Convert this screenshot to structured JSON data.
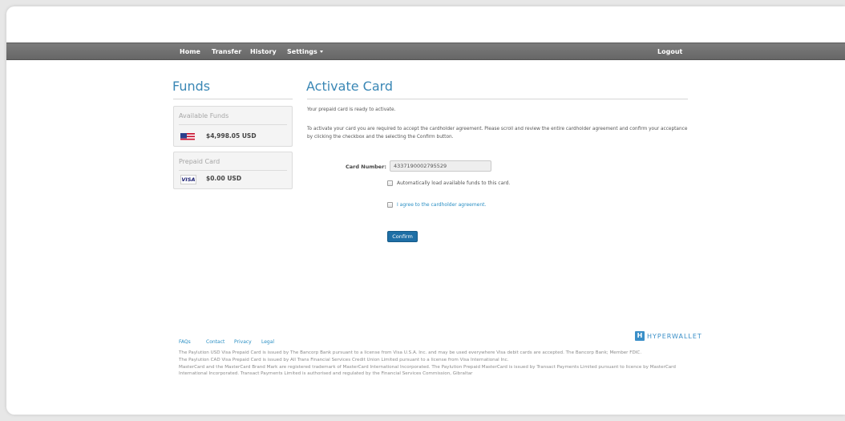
{
  "nav": {
    "home": "Home",
    "transfer": "Transfer",
    "history": "History",
    "settings": "Settings",
    "logout": "Logout"
  },
  "sidebar": {
    "title": "Funds",
    "available": {
      "label": "Available Funds",
      "amount": "$4,998.05 USD",
      "icon": "us-flag-icon"
    },
    "prepaid": {
      "label": "Prepaid Card",
      "amount": "$0.00 USD",
      "icon": "visa-icon",
      "brand": "VISA"
    }
  },
  "main": {
    "title": "Activate Card",
    "ready_text": "Your prepaid card is ready to activate.",
    "instructions": "To activate your card you are required to accept the cardholder agreement. Please scroll and review the entire cardholder agreement and confirm your acceptance by clicking the checkbox and the selecting the Confirm button.",
    "card_number_label": "Card Number:",
    "card_number_value": "4337190002795529",
    "auto_load_label": "Automatically load available funds to this card.",
    "agree_label": "I agree to the cardholder agreement.",
    "confirm_label": "Confirm"
  },
  "footer": {
    "links": [
      "FAQs",
      "Contact",
      "Privacy",
      "Legal"
    ],
    "line1": "The Paylution USD Visa Prepaid Card is issued by The Bancorp Bank pursuant to a license from Visa U.S.A. Inc. and may be used everywhere Visa debit cards are accepted. The Bancorp Bank; Member FDIC.",
    "line2": "The Paylution CAD Visa Prepaid Card is issued by All Trans Financial Services Credit Union Limited pursuant to a license from Visa International Inc.",
    "line3": "MasterCard and the MasterCard Brand Mark are registered trademark of MasterCard International Incorporated. The Paylution Prepaid MasterCard is issued by Transact Payments Limited pursuant to licence by MasterCard International Incorporated. Transact Payments Limited is authorised and regulated by the Financial Services Commission, Gibraltar",
    "brand": "HYPERWALLET",
    "brand_mark": "H"
  },
  "colors": {
    "accent": "#3a87b5",
    "navbar": "#6f6f6f",
    "button": "#1e6fa6"
  }
}
